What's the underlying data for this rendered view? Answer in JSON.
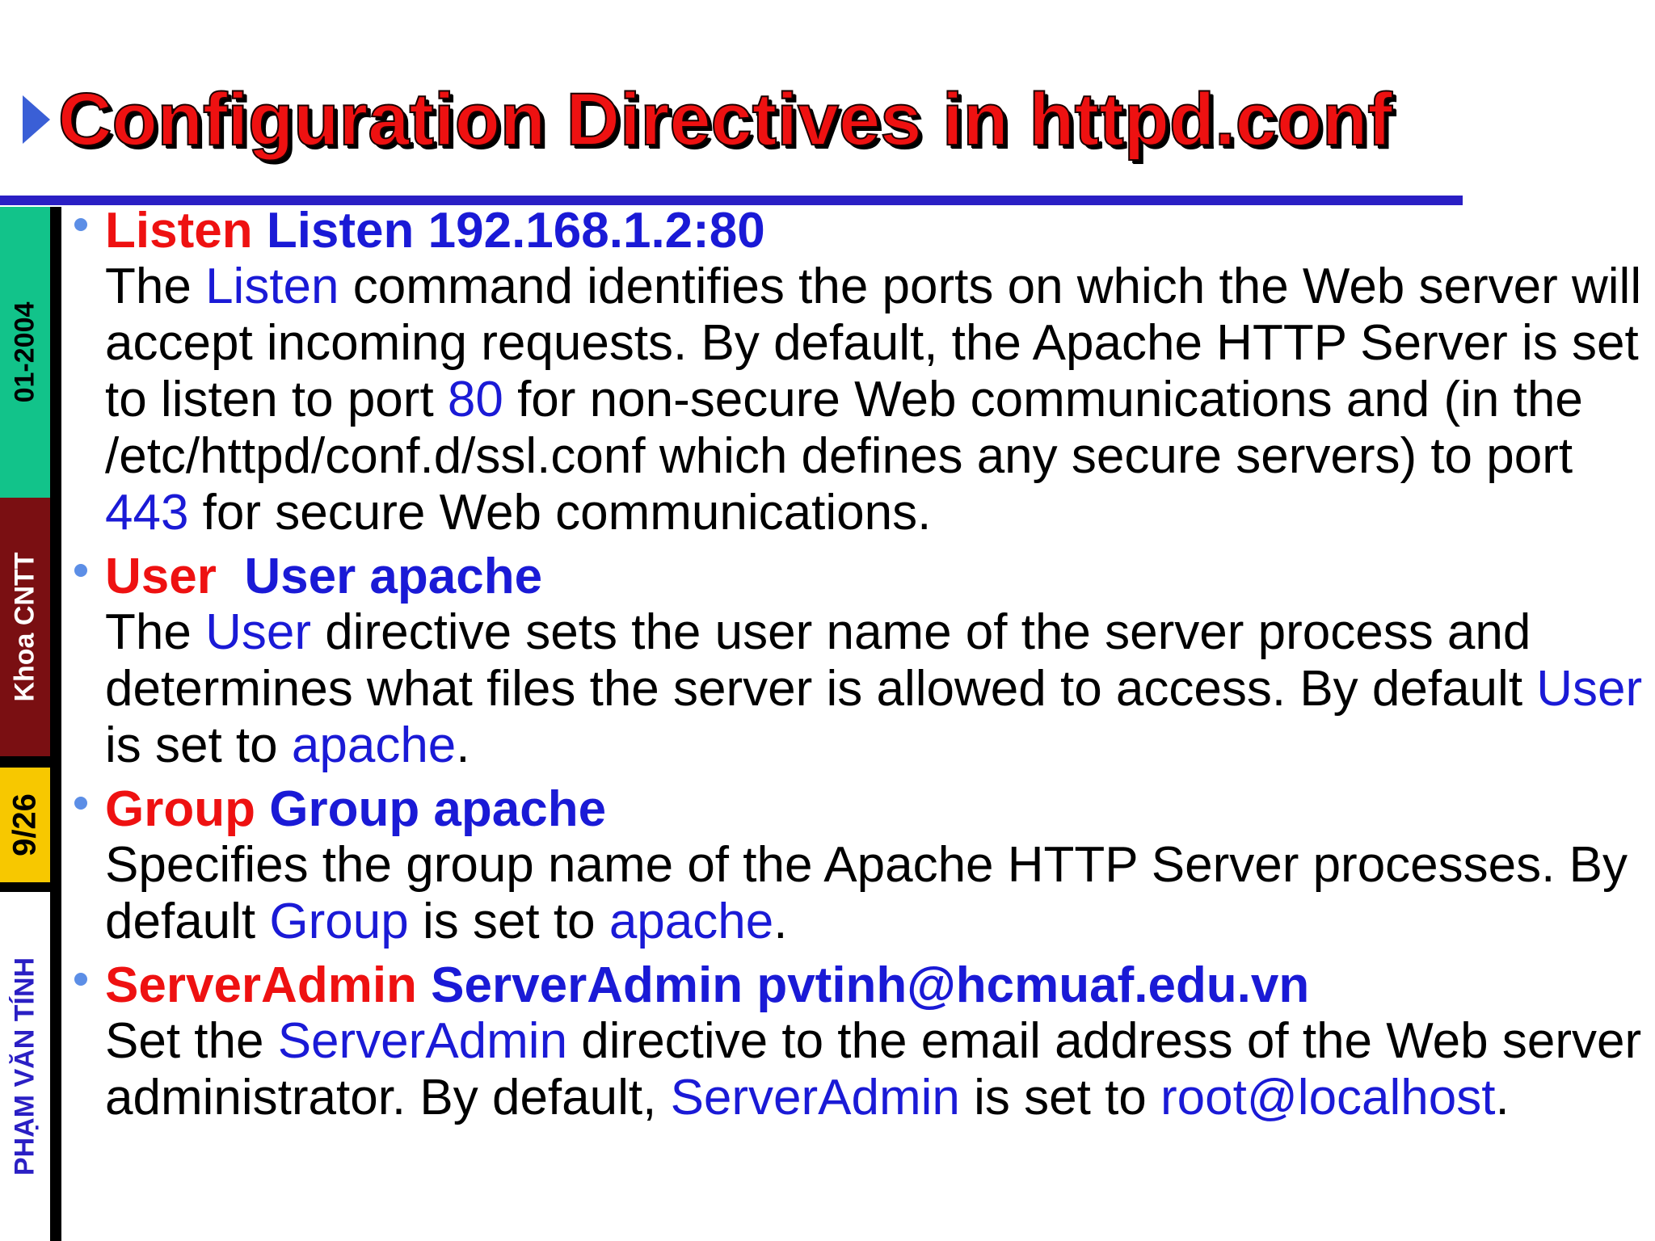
{
  "title": "Configuration Directives in httpd.conf",
  "side_band": {
    "date": "01-2004",
    "department": "Khoa CNTT",
    "page": "9/26",
    "author": "PHẠM VĂN TÍNH"
  },
  "colors": {
    "title_red": "#ee1111",
    "keyword_blue": "#1a1ad6",
    "rule_blue": "#2a1fc4",
    "band_green": "#12c38a",
    "band_maroon": "#7a0f12",
    "band_yellow": "#f7c800",
    "bullet_blue": "#5c8ee6"
  },
  "items": [
    {
      "directive": "Listen",
      "example": "Listen 192.168.1.2:80",
      "desc": {
        "t1": "The ",
        "h1": "Listen",
        "t2": " command identifies the ports on which the Web server will accept incoming requests. By default, the Apache HTTP Server is set to listen to port ",
        "h2": "80",
        "t3": " for non-secure Web communications and (in the /etc/httpd/conf.d/ssl.conf which defines any secure servers) to port ",
        "h3": "443",
        "t4": " for secure Web communications."
      }
    },
    {
      "directive": "User",
      "example": "User apache",
      "desc": {
        "t1": "The ",
        "h1": "User",
        "t2": " directive sets the user name of the server process and determines what files the server is allowed to access. By default ",
        "h2": "User",
        "t3": " is set to ",
        "h3": "apache",
        "t4": "."
      }
    },
    {
      "directive": "Group",
      "example": "Group apache",
      "desc": {
        "t1": "Specifies the group name of the Apache HTTP Server processes. By default ",
        "h1": "Group",
        "t2": " is set to ",
        "h2": "apache",
        "t3": "."
      }
    },
    {
      "directive": "ServerAdmin",
      "example": "ServerAdmin pvtinh@hcmuaf.edu.vn",
      "desc": {
        "t1": "Set the ",
        "h1": "ServerAdmin",
        "t2": " directive to the email address of the Web server administrator. By default, ",
        "h2": "ServerAdmin",
        "t3": " is set to ",
        "h3": "root@localhost",
        "t4": "."
      }
    }
  ]
}
